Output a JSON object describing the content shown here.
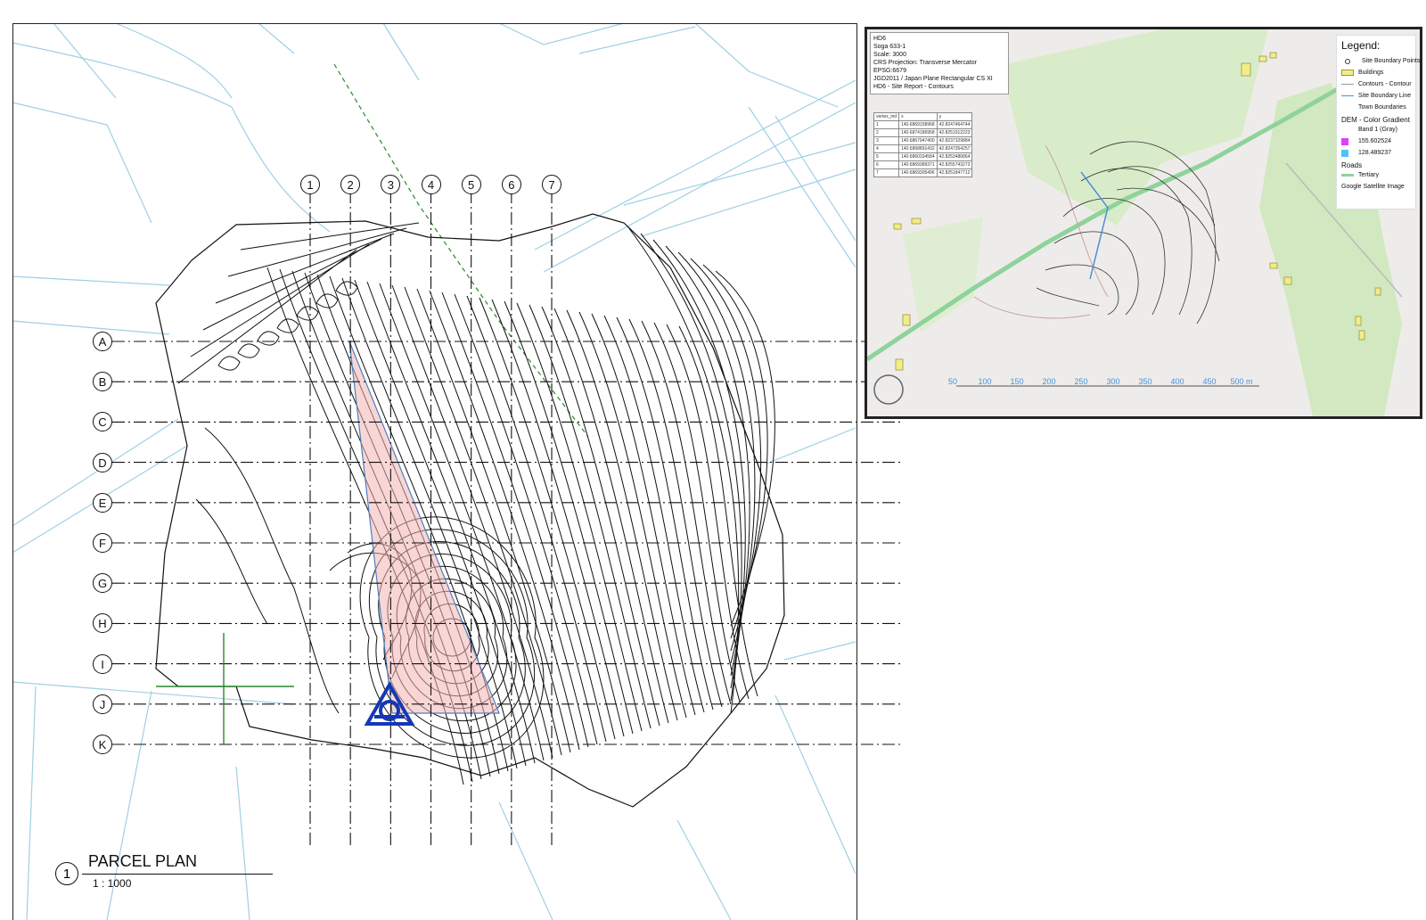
{
  "drawing": {
    "column_labels": [
      "1",
      "2",
      "3",
      "4",
      "5",
      "6",
      "7"
    ],
    "row_labels": [
      "A",
      "B",
      "C",
      "D",
      "E",
      "F",
      "G",
      "H",
      "I",
      "J",
      "K"
    ],
    "view_title": {
      "number": "1",
      "name": "PARCEL PLAN",
      "scale": "1 : 1000"
    }
  },
  "map_view": {
    "info_lines": [
      "HD6",
      "Soga 633-1",
      "Scale: 3000",
      "CRS Projection: Transverse Mercator",
      "EPSG:6679",
      "JGD2011 / Japan Plane Rectangular CS XI",
      "HD6 - Site Report - Contours"
    ],
    "table_headers": [
      "vertex_ind",
      "x",
      "y"
    ],
    "table_rows": [
      [
        "1",
        "140.6869158968",
        "42.8247464744"
      ],
      [
        "2",
        "140.6874186958",
        "42.8251912223"
      ],
      [
        "3",
        "140.6867947400",
        "42.8237329884"
      ],
      [
        "4",
        "140.6868891432",
        "42.8247354257"
      ],
      [
        "5",
        "140.6860334584",
        "42.8253486864"
      ],
      [
        "6",
        "140.6869389371",
        "42.8255743273"
      ],
      [
        "7",
        "140.6869305496",
        "42.8251847712"
      ]
    ],
    "legend": {
      "title": "Legend:",
      "items": [
        {
          "label": "Site Boundary Points",
          "symbol": "circle"
        },
        {
          "label": "Buildings",
          "symbol": "yellow-box"
        },
        {
          "label": "Contours - Contour",
          "symbol": "gray-line"
        },
        {
          "label": "Site Boundary Line",
          "symbol": "blue-line"
        },
        {
          "label": "Town Boundaries",
          "symbol": "none"
        }
      ],
      "dem_title": "DEM - Color Gradient",
      "dem_band": "Band 1 (Gray)",
      "dem_max": "155.602524",
      "dem_min": "128.489237",
      "roads_title": "Roads",
      "roads_item": "Tertiary",
      "satellite": "Google Satellite Image"
    },
    "scale_bar_labels": [
      "50",
      "100",
      "150",
      "200",
      "250",
      "300",
      "350",
      "400",
      "450",
      "500 m"
    ],
    "colors": {
      "building": "#f2ec8a",
      "road": "#8fd39a",
      "boundary": "#4d8fd6",
      "dem_high": "#e040fb",
      "dem_low": "#4fc3f7"
    }
  }
}
